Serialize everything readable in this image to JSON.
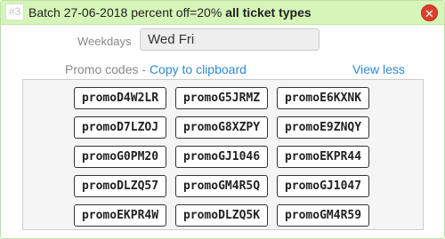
{
  "header": {
    "index_badge": "#3",
    "title_prefix": "Batch 27-06-2018 percent off=20%",
    "title_bold": "all ticket types",
    "close_symbol": "✕"
  },
  "weekdays": {
    "label": "Weekdays",
    "value": "Wed Fri"
  },
  "promo": {
    "label": "Promo codes - ",
    "copy_link": "Copy to clipboard",
    "view_less": "View less",
    "codes": [
      "promoD4W2LR",
      "promoG5JRMZ",
      "promoE6KXNK",
      "promoD7LZOJ",
      "promoG8XZPY",
      "promoE9ZNQY",
      "promoG0PM20",
      "promoGJ1046",
      "promoEKPR44",
      "promoDLZQ57",
      "promoGM4R5Q",
      "promoGJ1047",
      "promoEKPR4W",
      "promoDLZQ5K",
      "promoGM4R59"
    ]
  },
  "colors": {
    "header_bg": "#d6f5b8",
    "link": "#2a8bd6",
    "close": "#d9402b"
  }
}
